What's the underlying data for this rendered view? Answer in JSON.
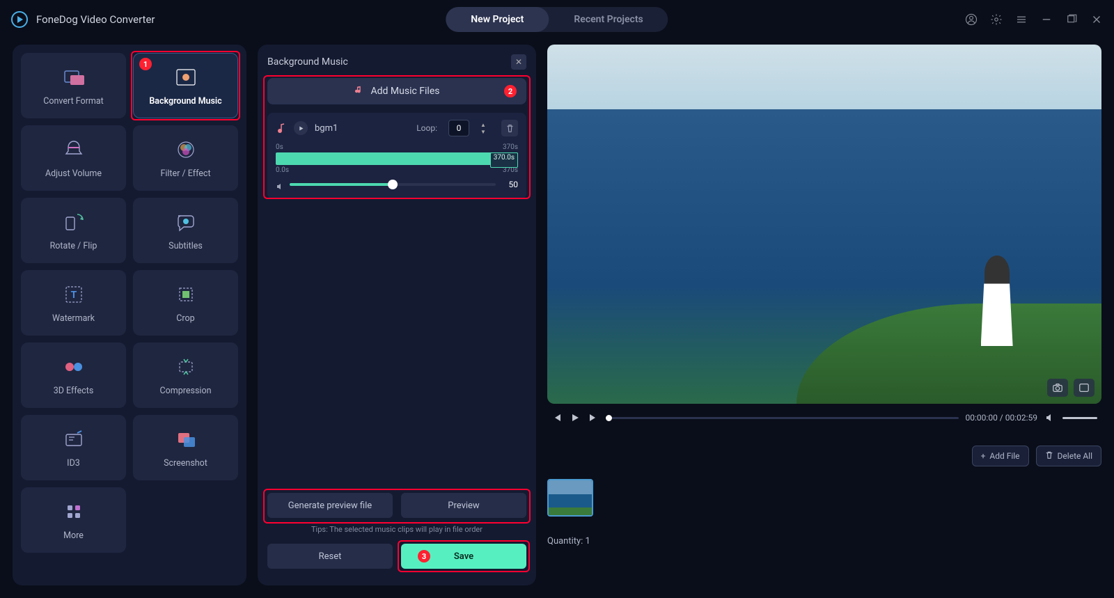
{
  "app": {
    "title": "FoneDog Video Converter"
  },
  "tabs": {
    "new_project": "New Project",
    "recent_projects": "Recent Projects"
  },
  "tools": [
    {
      "id": "convert-format",
      "label": "Convert Format"
    },
    {
      "id": "background-music",
      "label": "Background Music"
    },
    {
      "id": "adjust-volume",
      "label": "Adjust Volume"
    },
    {
      "id": "filter-effect",
      "label": "Filter / Effect"
    },
    {
      "id": "rotate-flip",
      "label": "Rotate / Flip"
    },
    {
      "id": "subtitles",
      "label": "Subtitles"
    },
    {
      "id": "watermark",
      "label": "Watermark"
    },
    {
      "id": "crop",
      "label": "Crop"
    },
    {
      "id": "3d-effects",
      "label": "3D Effects"
    },
    {
      "id": "compression",
      "label": "Compression"
    },
    {
      "id": "id3",
      "label": "ID3"
    },
    {
      "id": "screenshot",
      "label": "Screenshot"
    },
    {
      "id": "more",
      "label": "More"
    }
  ],
  "panel": {
    "title": "Background Music",
    "add_btn": "Add Music Files",
    "track": {
      "name": "bgm1",
      "loop_label": "Loop:",
      "loop_value": "0",
      "range_start": "0s",
      "range_end": "370s",
      "wave_label": "370.0s",
      "vol_start": "0.0s",
      "vol_end": "370s",
      "volume": "50"
    },
    "generate": "Generate preview file",
    "preview": "Preview",
    "tips": "Tips: The selected music clips will play in file order",
    "reset": "Reset",
    "save": "Save"
  },
  "player": {
    "time": "00:00:00 / 00:02:59"
  },
  "files": {
    "add": "Add File",
    "delete_all": "Delete All",
    "quantity": "Quantity: 1"
  },
  "callouts": {
    "c1": "1",
    "c2": "2",
    "c3": "3"
  },
  "colors": {
    "accent": "#56f0c0",
    "annot": "#ff0030"
  }
}
